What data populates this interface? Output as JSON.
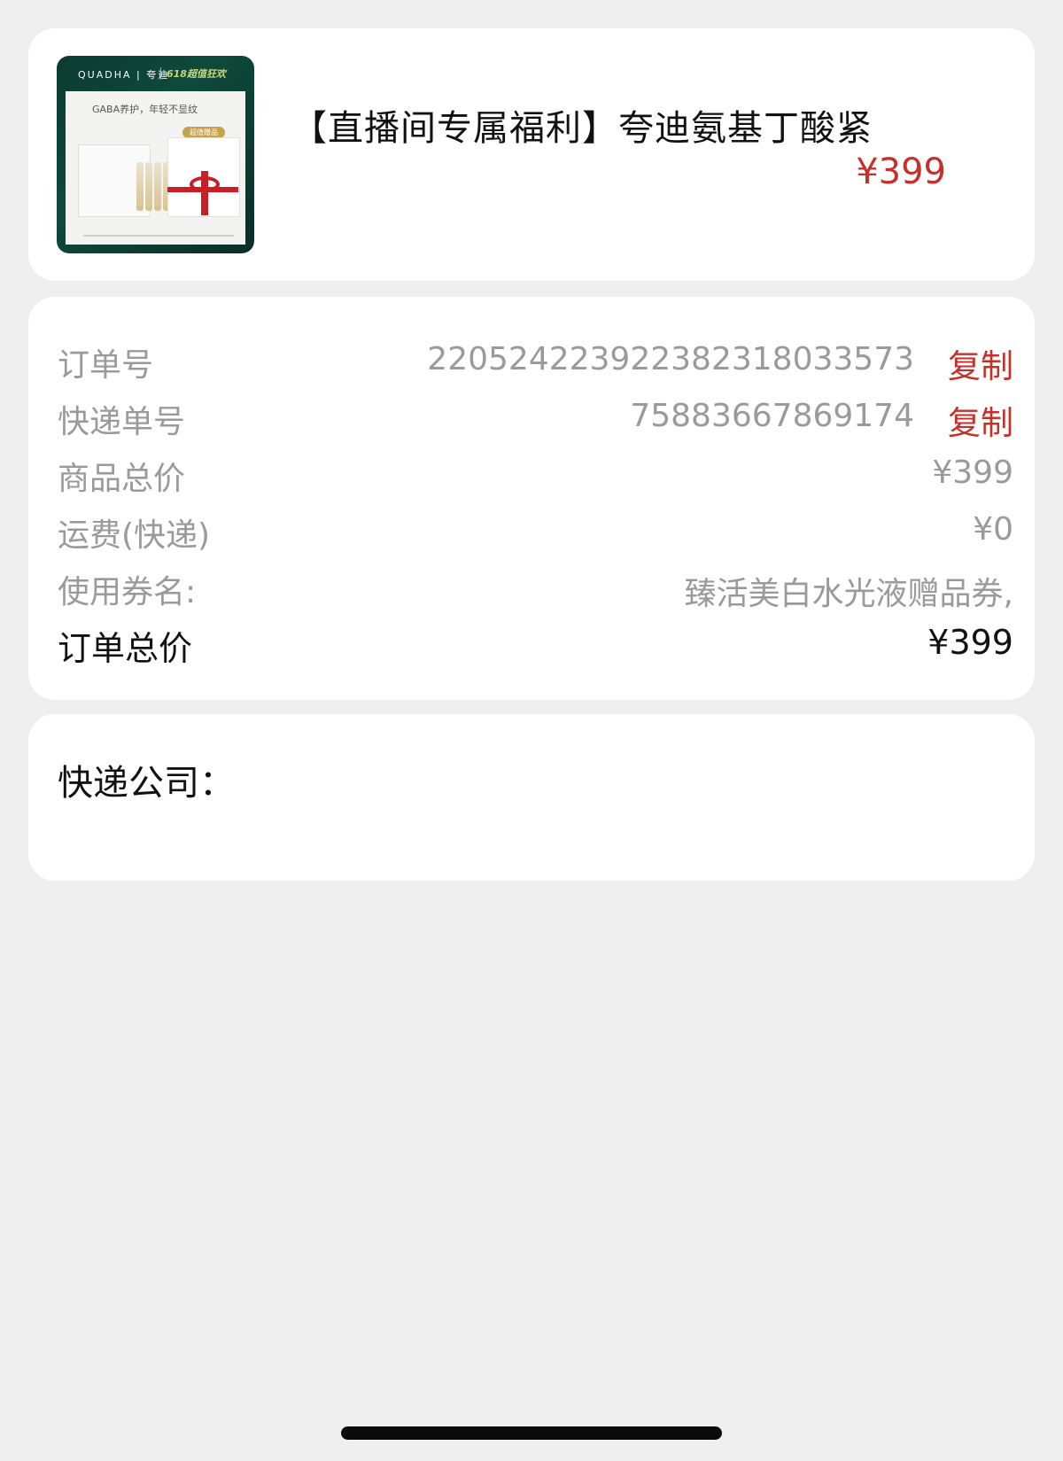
{
  "product": {
    "image_brand": "QUADHA | 夸迪",
    "image_badge": "618超值狂欢",
    "image_tagline": "GABA养护，年轻不显纹",
    "image_pill": "超值赠品",
    "title": "【直播间专属福利】夸迪氨基丁酸紧",
    "price": "¥399"
  },
  "order": {
    "rows": [
      {
        "label": "订单号",
        "value": "220524223922382318033573",
        "copy": "复制"
      },
      {
        "label": "快递单号",
        "value": "75883667869174",
        "copy": "复制"
      },
      {
        "label": "商品总价",
        "value": "¥399"
      },
      {
        "label": "运费(快递)",
        "value": "¥0"
      },
      {
        "label": "使用券名:",
        "value": "臻活美白水光液赠品券,"
      },
      {
        "label": "订单总价",
        "value": "¥399"
      }
    ]
  },
  "express": {
    "label": "快递公司："
  },
  "colors": {
    "accent": "#c62f2a",
    "background": "#efefef",
    "card": "#ffffff",
    "muted_text": "#9a9a9a"
  }
}
